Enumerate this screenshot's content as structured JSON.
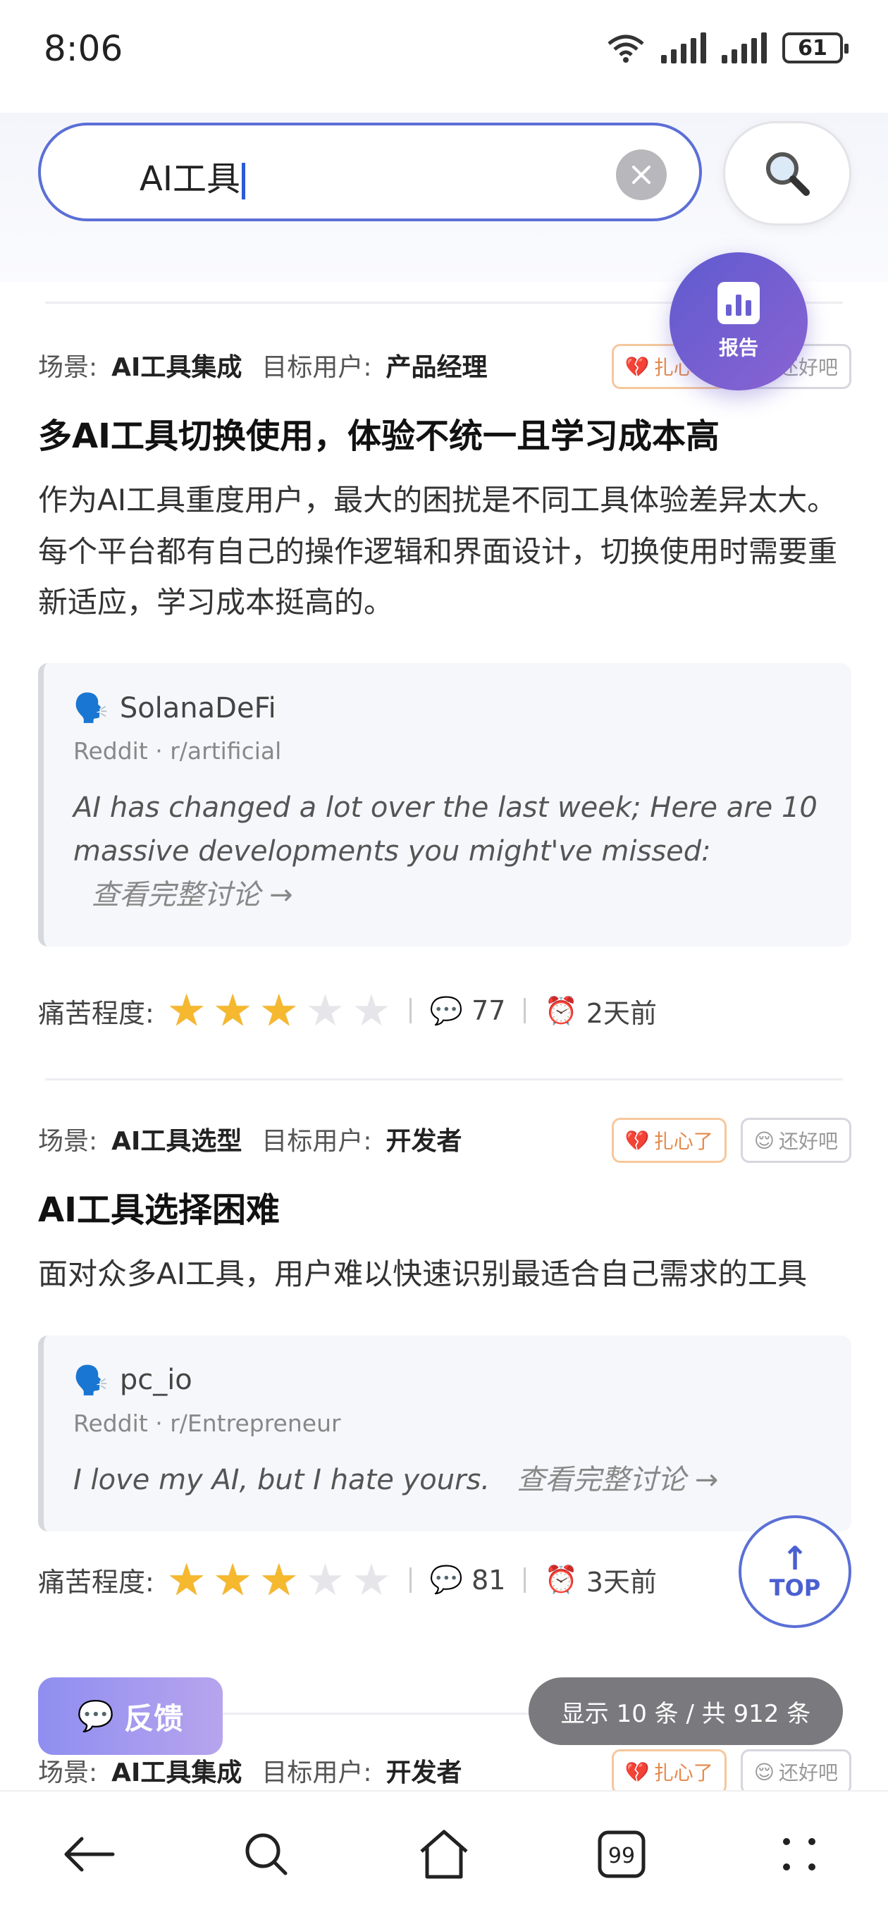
{
  "status": {
    "time": "8:06",
    "battery": "61"
  },
  "search": {
    "query": "AI工具"
  },
  "report": {
    "label": "报告"
  },
  "labels": {
    "scene": "场景:",
    "target": "目标用户:",
    "pain": "痛苦程度:",
    "hurt": "扎心了",
    "ok": "还好吧"
  },
  "cards": [
    {
      "scene": "AI工具集成",
      "target": "产品经理",
      "title": "多AI工具切换使用，体验不统一且学习成本高",
      "desc": "作为AI工具重度用户，最大的困扰是不同工具体验差异太大。每个平台都有自己的操作逻辑和界面设计，切换使用时需要重新适应，学习成本挺高的。",
      "user": "SolanaDeFi",
      "source": "Reddit · r/artificial",
      "quote": "AI has changed a lot over the last week; Here are 10 massive developments you might've missed:",
      "link": "查看完整讨论 →",
      "stars": 3,
      "comments": "77",
      "time": "2天前"
    },
    {
      "scene": "AI工具选型",
      "target": "开发者",
      "title": "AI工具选择困难",
      "desc": "面对众多AI工具，用户难以快速识别最适合自己需求的工具",
      "user": "pc_io",
      "source": "Reddit · r/Entrepreneur",
      "quote": "I love my AI, but I hate yours.",
      "link": "查看完整讨论 →",
      "stars": 3,
      "comments": "81",
      "time": "3天前"
    },
    {
      "scene": "AI工具集成",
      "target": "开发者"
    }
  ],
  "floating": {
    "top": "TOP",
    "feedback": "反馈",
    "count": "显示 10 条 / 共 912 条"
  },
  "icons": [
    "wifi-icon",
    "signal-icon",
    "battery-icon",
    "clear-icon",
    "search-icon",
    "chart-icon",
    "speech-icon",
    "comment-icon",
    "alarm-icon",
    "broken-heart-icon",
    "relieved-face-icon",
    "back-icon",
    "home-icon",
    "tabs-icon",
    "menu-icon"
  ]
}
